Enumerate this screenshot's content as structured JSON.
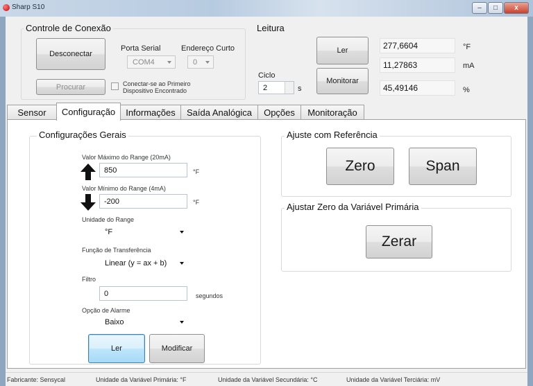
{
  "window": {
    "title": "Sharp S10",
    "controls": {
      "minimize": "–",
      "maximize": "□",
      "close": "x"
    }
  },
  "connection": {
    "title": "Controle de Conexão",
    "disconnect_label": "Desconectar",
    "search_label": "Procurar",
    "serial_port_label": "Porta Serial",
    "serial_port_value": "COM4",
    "short_address_label": "Endereço Curto",
    "short_address_value": "0",
    "auto_connect_line1": "Conectar-se ao Primeiro",
    "auto_connect_line2": "Dispositivo Encontrado"
  },
  "reading": {
    "title": "Leitura",
    "read_label": "Ler",
    "monitor_label": "Monitorar",
    "cycle_label": "Ciclo",
    "cycle_value": "2",
    "cycle_unit": "s",
    "values": [
      {
        "value": "277,6604",
        "unit": "°F"
      },
      {
        "value": "11,27863",
        "unit": "mA"
      },
      {
        "value": "45,49146",
        "unit": "%"
      }
    ]
  },
  "tabs": [
    "Sensor",
    "Configuração",
    "Informações",
    "Saída Analógica",
    "Opções",
    "Monitoração"
  ],
  "general": {
    "title": "Configurações Gerais",
    "max_range_label": "Valor Máximo do Range (20mA)",
    "max_range_value": "850",
    "max_range_unit": "°F",
    "min_range_label": "Valor Mínimo do Range (4mA)",
    "min_range_value": "-200",
    "min_range_unit": "°F",
    "range_unit_label": "Unidade do Range",
    "range_unit_value": "°F",
    "transfer_label": "Função de Transferência",
    "transfer_value": "Linear (y = ax + b)",
    "filter_label": "Filtro",
    "filter_value": "0",
    "filter_unit": "segundos",
    "alarm_label": "Opção de Alarme",
    "alarm_value": "Baixo",
    "read_label": "Ler",
    "modify_label": "Modificar"
  },
  "reference": {
    "title": "Ajuste com Referência",
    "zero_label": "Zero",
    "span_label": "Span"
  },
  "zero_primary": {
    "title": "Ajustar Zero da Variável Primária",
    "reset_label": "Zerar"
  },
  "status": {
    "manufacturer": "Fabricante: Sensycal",
    "primary_unit": "Unidade da Variável Primária: °F",
    "secondary_unit": "Unidade da Variável Secundária: °C",
    "tertiary_unit": "Unidade da Variável Terciária: mV"
  }
}
